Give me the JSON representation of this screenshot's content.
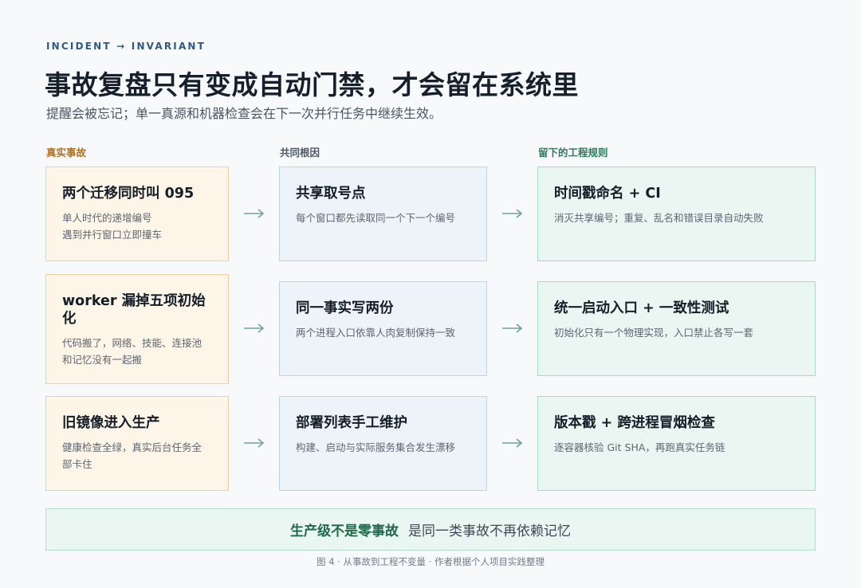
{
  "header": {
    "eyebrow": "INCIDENT → INVARIANT",
    "title": "事故复盘只有变成自动门禁，才会留在系统里",
    "subtitle": "提醒会被忘记；单一真源和机器检查会在下一次并行任务中继续生效。"
  },
  "colors": {
    "incident": "#b3701f",
    "root_cause": "#4f5a66",
    "rule": "#2f7a5c",
    "arrow": "#6fa58e"
  },
  "columns": [
    {
      "label": "真实事故"
    },
    {
      "label": "共同根因"
    },
    {
      "label": "留下的工程规则"
    }
  ],
  "rows": [
    {
      "incident": {
        "title": "两个迁移同时叫 095",
        "body": "单人时代的递增编号\n遇到并行窗口立即撞车"
      },
      "cause": {
        "title": "共享取号点",
        "body": "每个窗口都先读取同一个下一个编号"
      },
      "rule": {
        "title": "时间戳命名 + CI",
        "body": "消灭共享编号；重复、乱名和错误目录自动失败"
      }
    },
    {
      "incident": {
        "title": "worker 漏掉五项初始化",
        "body": "代码搬了，网络、技能、连接池\n和记忆没有一起搬"
      },
      "cause": {
        "title": "同一事实写两份",
        "body": "两个进程入口依靠人肉复制保持一致"
      },
      "rule": {
        "title": "统一启动入口 + 一致性测试",
        "body": "初始化只有一个物理实现，入口禁止各写一套"
      }
    },
    {
      "incident": {
        "title": "旧镜像进入生产",
        "body": "健康检查全绿，真实后台任务全\n部卡住"
      },
      "cause": {
        "title": "部署列表手工维护",
        "body": "构建、启动与实际服务集合发生漂移"
      },
      "rule": {
        "title": "版本戳 + 跨进程冒烟检查",
        "body": "逐容器核验 Git SHA，再跑真实任务链"
      }
    }
  ],
  "footer": {
    "strong": "生产级不是零事故",
    "normal": "是同一类事故不再依赖记忆"
  },
  "caption": "图 4 · 从事故到工程不变量 · 作者根据个人项目实践整理"
}
